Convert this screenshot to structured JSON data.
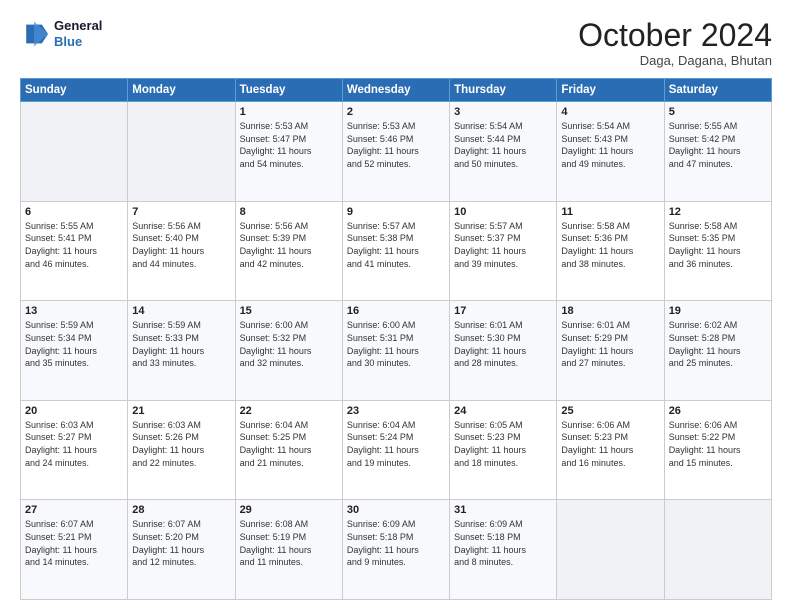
{
  "logo": {
    "line1": "General",
    "line2": "Blue"
  },
  "header": {
    "month": "October 2024",
    "location": "Daga, Dagana, Bhutan"
  },
  "weekdays": [
    "Sunday",
    "Monday",
    "Tuesday",
    "Wednesday",
    "Thursday",
    "Friday",
    "Saturday"
  ],
  "weeks": [
    [
      {
        "day": "",
        "text": ""
      },
      {
        "day": "",
        "text": ""
      },
      {
        "day": "1",
        "text": "Sunrise: 5:53 AM\nSunset: 5:47 PM\nDaylight: 11 hours\nand 54 minutes."
      },
      {
        "day": "2",
        "text": "Sunrise: 5:53 AM\nSunset: 5:46 PM\nDaylight: 11 hours\nand 52 minutes."
      },
      {
        "day": "3",
        "text": "Sunrise: 5:54 AM\nSunset: 5:44 PM\nDaylight: 11 hours\nand 50 minutes."
      },
      {
        "day": "4",
        "text": "Sunrise: 5:54 AM\nSunset: 5:43 PM\nDaylight: 11 hours\nand 49 minutes."
      },
      {
        "day": "5",
        "text": "Sunrise: 5:55 AM\nSunset: 5:42 PM\nDaylight: 11 hours\nand 47 minutes."
      }
    ],
    [
      {
        "day": "6",
        "text": "Sunrise: 5:55 AM\nSunset: 5:41 PM\nDaylight: 11 hours\nand 46 minutes."
      },
      {
        "day": "7",
        "text": "Sunrise: 5:56 AM\nSunset: 5:40 PM\nDaylight: 11 hours\nand 44 minutes."
      },
      {
        "day": "8",
        "text": "Sunrise: 5:56 AM\nSunset: 5:39 PM\nDaylight: 11 hours\nand 42 minutes."
      },
      {
        "day": "9",
        "text": "Sunrise: 5:57 AM\nSunset: 5:38 PM\nDaylight: 11 hours\nand 41 minutes."
      },
      {
        "day": "10",
        "text": "Sunrise: 5:57 AM\nSunset: 5:37 PM\nDaylight: 11 hours\nand 39 minutes."
      },
      {
        "day": "11",
        "text": "Sunrise: 5:58 AM\nSunset: 5:36 PM\nDaylight: 11 hours\nand 38 minutes."
      },
      {
        "day": "12",
        "text": "Sunrise: 5:58 AM\nSunset: 5:35 PM\nDaylight: 11 hours\nand 36 minutes."
      }
    ],
    [
      {
        "day": "13",
        "text": "Sunrise: 5:59 AM\nSunset: 5:34 PM\nDaylight: 11 hours\nand 35 minutes."
      },
      {
        "day": "14",
        "text": "Sunrise: 5:59 AM\nSunset: 5:33 PM\nDaylight: 11 hours\nand 33 minutes."
      },
      {
        "day": "15",
        "text": "Sunrise: 6:00 AM\nSunset: 5:32 PM\nDaylight: 11 hours\nand 32 minutes."
      },
      {
        "day": "16",
        "text": "Sunrise: 6:00 AM\nSunset: 5:31 PM\nDaylight: 11 hours\nand 30 minutes."
      },
      {
        "day": "17",
        "text": "Sunrise: 6:01 AM\nSunset: 5:30 PM\nDaylight: 11 hours\nand 28 minutes."
      },
      {
        "day": "18",
        "text": "Sunrise: 6:01 AM\nSunset: 5:29 PM\nDaylight: 11 hours\nand 27 minutes."
      },
      {
        "day": "19",
        "text": "Sunrise: 6:02 AM\nSunset: 5:28 PM\nDaylight: 11 hours\nand 25 minutes."
      }
    ],
    [
      {
        "day": "20",
        "text": "Sunrise: 6:03 AM\nSunset: 5:27 PM\nDaylight: 11 hours\nand 24 minutes."
      },
      {
        "day": "21",
        "text": "Sunrise: 6:03 AM\nSunset: 5:26 PM\nDaylight: 11 hours\nand 22 minutes."
      },
      {
        "day": "22",
        "text": "Sunrise: 6:04 AM\nSunset: 5:25 PM\nDaylight: 11 hours\nand 21 minutes."
      },
      {
        "day": "23",
        "text": "Sunrise: 6:04 AM\nSunset: 5:24 PM\nDaylight: 11 hours\nand 19 minutes."
      },
      {
        "day": "24",
        "text": "Sunrise: 6:05 AM\nSunset: 5:23 PM\nDaylight: 11 hours\nand 18 minutes."
      },
      {
        "day": "25",
        "text": "Sunrise: 6:06 AM\nSunset: 5:23 PM\nDaylight: 11 hours\nand 16 minutes."
      },
      {
        "day": "26",
        "text": "Sunrise: 6:06 AM\nSunset: 5:22 PM\nDaylight: 11 hours\nand 15 minutes."
      }
    ],
    [
      {
        "day": "27",
        "text": "Sunrise: 6:07 AM\nSunset: 5:21 PM\nDaylight: 11 hours\nand 14 minutes."
      },
      {
        "day": "28",
        "text": "Sunrise: 6:07 AM\nSunset: 5:20 PM\nDaylight: 11 hours\nand 12 minutes."
      },
      {
        "day": "29",
        "text": "Sunrise: 6:08 AM\nSunset: 5:19 PM\nDaylight: 11 hours\nand 11 minutes."
      },
      {
        "day": "30",
        "text": "Sunrise: 6:09 AM\nSunset: 5:18 PM\nDaylight: 11 hours\nand 9 minutes."
      },
      {
        "day": "31",
        "text": "Sunrise: 6:09 AM\nSunset: 5:18 PM\nDaylight: 11 hours\nand 8 minutes."
      },
      {
        "day": "",
        "text": ""
      },
      {
        "day": "",
        "text": ""
      }
    ]
  ]
}
